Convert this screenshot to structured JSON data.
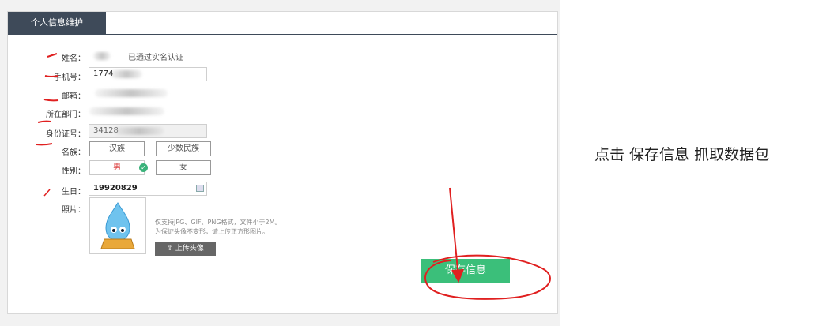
{
  "panel": {
    "tab_title": "个人信息维护"
  },
  "form": {
    "name_label": "姓名：",
    "name_status": "已通过实名认证",
    "phone_label": "手机号：",
    "phone_value": "1774",
    "email_label": "邮箱：",
    "dept_label": "所在部门：",
    "idcard_label": "身份证号：",
    "idcard_value": "34128",
    "ethnicity_label": "名族：",
    "ethnicity_options": [
      "汉族",
      "少数民族"
    ],
    "gender_label": "性别：",
    "gender_options": [
      "男",
      "女"
    ],
    "gender_selected": "男",
    "birthday_label": "生日：",
    "birthday_value": "19920829",
    "photo_label": "照片：",
    "photo_hint_1": "仅支持JPG、GIF、PNG格式，文件小于2M。",
    "photo_hint_2": "为保证头像不变形，请上传正方形图片。",
    "upload_button": "上传头像",
    "save_button": "保存信息"
  },
  "annotation": {
    "side_note": "点击 保存信息 抓取数据包",
    "accent_color": "#e02020"
  },
  "colors": {
    "tab_bg": "#3e4a59",
    "save_bg": "#3bbf7a",
    "check": "#3ab27a"
  }
}
